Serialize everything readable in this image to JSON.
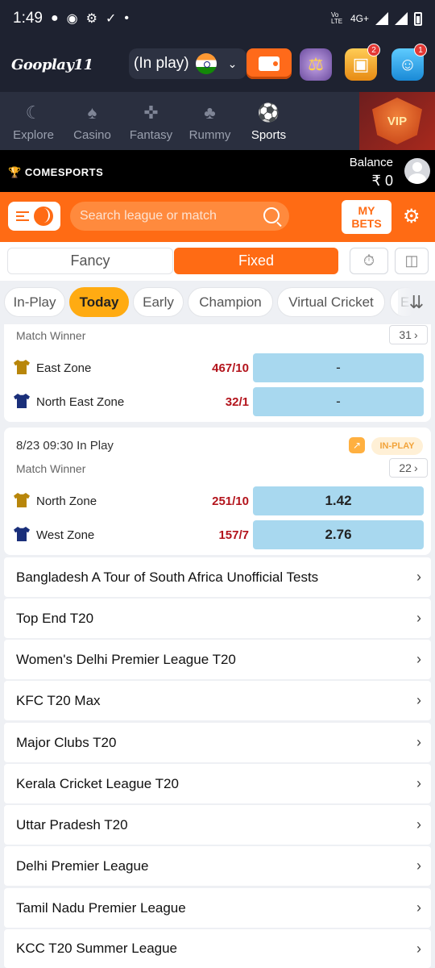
{
  "status": {
    "time": "1:49",
    "network": "4G+",
    "lte": "Vo LTE"
  },
  "header": {
    "logo": "Gooplay11",
    "play_filter": "(In play)",
    "badges": {
      "chest": "2",
      "agent": "1"
    }
  },
  "categories": [
    {
      "label": "Explore",
      "icon": "planet-icon"
    },
    {
      "label": "Casino",
      "icon": "spade-icon"
    },
    {
      "label": "Fantasy",
      "icon": "cricket-bat-icon"
    },
    {
      "label": "Rummy",
      "icon": "cards-icon"
    },
    {
      "label": "Sports",
      "icon": "football-icon"
    }
  ],
  "vip_label": "VIP",
  "comesports": {
    "logo": "COMESPORTS",
    "balance_label": "Balance",
    "balance_value": "₹ 0"
  },
  "toolbar": {
    "search_placeholder": "Search league or match",
    "my_bets_line1": "MY",
    "my_bets_line2": "BETS"
  },
  "segments": {
    "fancy": "Fancy",
    "fixed": "Fixed",
    "active": "Fixed"
  },
  "tabs": [
    "In-Play",
    "Today",
    "Early",
    "Champion",
    "Virtual Cricket",
    "E"
  ],
  "active_tab": "Today",
  "matches": [
    {
      "market": "Match Winner",
      "more_count": "31",
      "teams": [
        {
          "name": "East Zone",
          "score": "467/10",
          "odds": "-",
          "shirt_color": "#b8860b"
        },
        {
          "name": "North East Zone",
          "score": "32/1",
          "odds": "-",
          "shirt_color": "#1a2f7a"
        }
      ]
    },
    {
      "time": "8/23 09:30 In Play",
      "status": "IN-PLAY",
      "market": "Match Winner",
      "more_count": "22",
      "teams": [
        {
          "name": "North Zone",
          "score": "251/10",
          "odds": "1.42",
          "shirt_color": "#b8860b"
        },
        {
          "name": "West Zone",
          "score": "157/7",
          "odds": "2.76",
          "shirt_color": "#1a2f7a"
        }
      ]
    }
  ],
  "leagues": [
    "Bangladesh A Tour of South Africa Unofficial Tests",
    "Top End T20",
    "Women's Delhi Premier League T20",
    "KFC T20 Max",
    "Major Clubs T20",
    "Kerala Cricket League T20",
    "Uttar Pradesh T20",
    "Delhi Premier League",
    "Tamil Nadu Premier League",
    "KCC T20 Summer League"
  ],
  "colors": {
    "accent": "#ff6b14",
    "odds_bg": "#a8d8ef",
    "score": "#b3141c",
    "active_tab": "#ffab12"
  }
}
